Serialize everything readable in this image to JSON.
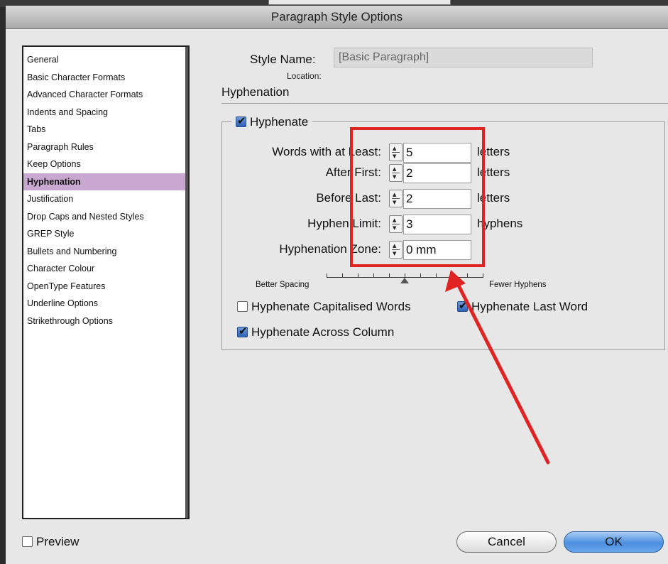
{
  "dialog": {
    "title": "Paragraph Style Options"
  },
  "sidebar": {
    "items": [
      {
        "label": "General"
      },
      {
        "label": "Basic Character Formats"
      },
      {
        "label": "Advanced Character Formats"
      },
      {
        "label": "Indents and Spacing"
      },
      {
        "label": "Tabs"
      },
      {
        "label": "Paragraph Rules"
      },
      {
        "label": "Keep Options"
      },
      {
        "label": "Hyphenation",
        "selected": true
      },
      {
        "label": "Justification"
      },
      {
        "label": "Drop Caps and Nested Styles"
      },
      {
        "label": "GREP Style"
      },
      {
        "label": "Bullets and Numbering"
      },
      {
        "label": "Character Colour"
      },
      {
        "label": "OpenType Features"
      },
      {
        "label": "Underline Options"
      },
      {
        "label": "Strikethrough Options"
      }
    ]
  },
  "style_name": {
    "label": "Style Name:",
    "value": "[Basic Paragraph]",
    "location_label": "Location:"
  },
  "section": {
    "title": "Hyphenation"
  },
  "hyphenate": {
    "label": "Hyphenate",
    "checked": true
  },
  "fields": {
    "words_with_at_least": {
      "label": "Words with at Least:",
      "value": "5",
      "unit": "letters"
    },
    "after_first": {
      "label": "After First:",
      "value": "2",
      "unit": "letters"
    },
    "before_last": {
      "label": "Before Last:",
      "value": "2",
      "unit": "letters"
    },
    "hyphen_limit": {
      "label": "Hyphen Limit:",
      "value": "3",
      "unit": "hyphens"
    },
    "hyphenation_zone": {
      "label": "Hyphenation Zone:",
      "value": "0 mm"
    }
  },
  "slider": {
    "left_label": "Better Spacing",
    "right_label": "Fewer Hyphens",
    "ticks": 11,
    "position_fraction": 0.5
  },
  "options": {
    "capitalised": {
      "label": "Hyphenate Capitalised Words",
      "checked": false
    },
    "last_word": {
      "label": "Hyphenate Last Word",
      "checked": true
    },
    "across_column": {
      "label": "Hyphenate Across Column",
      "checked": true
    }
  },
  "footer": {
    "preview_label": "Preview",
    "preview_checked": false,
    "cancel_label": "Cancel",
    "ok_label": "OK"
  },
  "colors": {
    "selection": "#c8a8d0",
    "annotation": "#e02424",
    "default_button": "#4c8ee0"
  }
}
